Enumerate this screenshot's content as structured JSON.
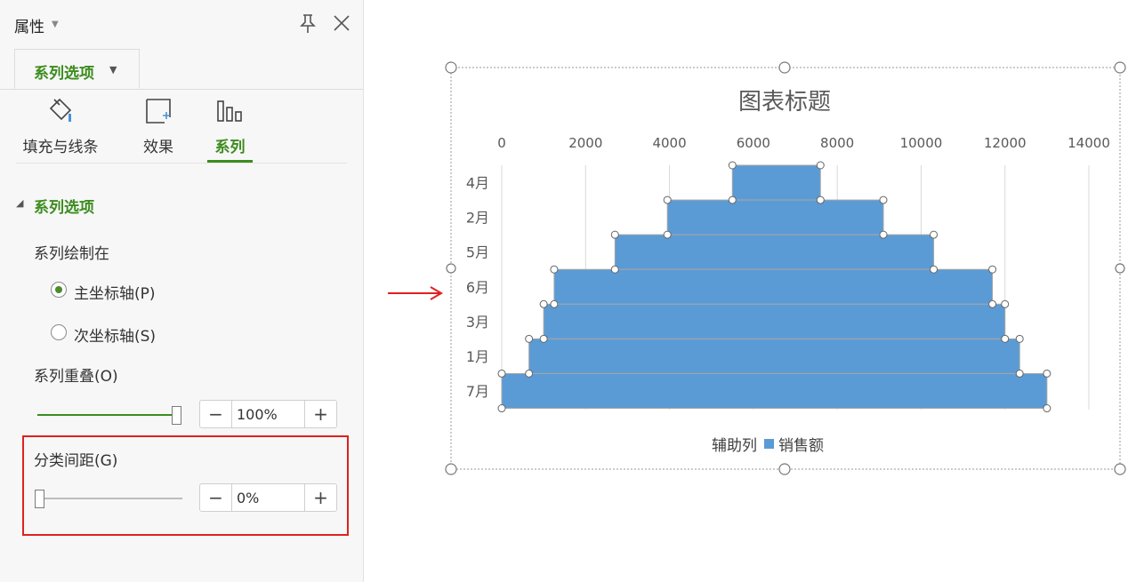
{
  "panel": {
    "title": "属性",
    "tab": "系列选项",
    "subtabs": [
      "填充与线条",
      "效果",
      "系列"
    ],
    "section_title": "系列选项",
    "plot_on_label": "系列绘制在",
    "primary_axis_label": "主坐标轴(P)",
    "secondary_axis_label": "次坐标轴(S)",
    "primary_axis_selected": true,
    "overlap_label": "系列重叠(O)",
    "overlap_value": "100%",
    "overlap_fraction": 1.0,
    "gap_label": "分类间距(G)",
    "gap_value": "0%",
    "gap_fraction": 0.0,
    "minus_symbol": "−",
    "plus_symbol": "+"
  },
  "icons": {
    "pin": "pin-icon",
    "close": "close-icon",
    "fill": "paint-bucket-icon",
    "effects": "effects-icon",
    "series": "bar-series-icon"
  },
  "colors": {
    "accent_green": "#3c8c1e",
    "highlight_red": "#e02020",
    "bar_blue": "#5b9bd5"
  },
  "chart_data": {
    "type": "bar",
    "orientation": "horizontal",
    "stacked": true,
    "title": "图表标题",
    "categories": [
      "4月",
      "2月",
      "5月",
      "6月",
      "3月",
      "1月",
      "7月"
    ],
    "series": [
      {
        "name": "辅助列",
        "values": [
          5500,
          3950,
          2700,
          1250,
          1000,
          650,
          0
        ],
        "visible": false
      },
      {
        "name": "销售额",
        "values": [
          2100,
          5150,
          7600,
          10450,
          11000,
          11700,
          13000
        ],
        "color": "#5b9bd5"
      }
    ],
    "xlim": [
      0,
      14000
    ],
    "x_ticks": [
      "0",
      "2000",
      "4000",
      "6000",
      "8000",
      "10000",
      "12000",
      "14000"
    ],
    "x_axis_position": "top",
    "grid": true,
    "legend": "bottom",
    "legend_entries": [
      "辅助列",
      "销售额"
    ],
    "gap_width": "0%"
  }
}
